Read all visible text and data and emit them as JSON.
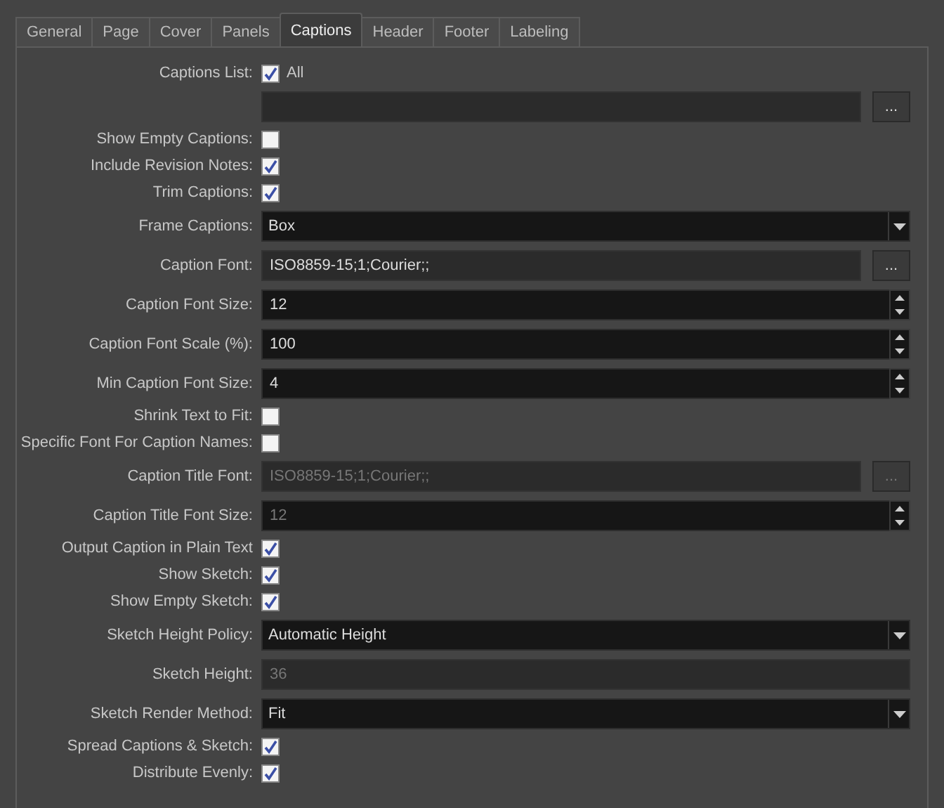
{
  "tabs": [
    {
      "label": "General",
      "selected": false
    },
    {
      "label": "Page",
      "selected": false
    },
    {
      "label": "Cover",
      "selected": false
    },
    {
      "label": "Panels",
      "selected": false
    },
    {
      "label": "Captions",
      "selected": true
    },
    {
      "label": "Header",
      "selected": false
    },
    {
      "label": "Footer",
      "selected": false
    },
    {
      "label": "Labeling",
      "selected": false
    }
  ],
  "rows": [
    {
      "kind": "checkbox",
      "label": "Captions List:",
      "checked": true,
      "text": "All"
    },
    {
      "kind": "browse",
      "button": "..."
    },
    {
      "kind": "checkbox",
      "label": "Show Empty Captions:",
      "checked": false
    },
    {
      "kind": "checkbox",
      "label": "Include Revision Notes:",
      "checked": true
    },
    {
      "kind": "checkbox",
      "label": "Trim Captions:",
      "checked": true
    },
    {
      "kind": "combo",
      "label": "Frame Captions:",
      "value": "Box"
    },
    {
      "kind": "browse",
      "label": "Caption Font:",
      "value": "ISO8859-15;1;Courier;;",
      "disabled": false,
      "button": "..."
    },
    {
      "kind": "spin",
      "label": "Caption Font Size:",
      "value": "12",
      "disabled": false
    },
    {
      "kind": "spin",
      "label": "Caption Font Scale (%):",
      "value": "100",
      "disabled": false
    },
    {
      "kind": "spin",
      "label": "Min Caption Font Size:",
      "value": "4",
      "disabled": false
    },
    {
      "kind": "checkbox",
      "label": "Shrink Text to Fit:",
      "checked": false
    },
    {
      "kind": "checkbox",
      "label": "Specific Font For Caption Names:",
      "checked": false
    },
    {
      "kind": "browse",
      "label": "Caption Title Font:",
      "value": "ISO8859-15;1;Courier;;",
      "disabled": true,
      "button": "..."
    },
    {
      "kind": "spin",
      "label": "Caption Title Font Size:",
      "value": "12",
      "disabled": true
    },
    {
      "kind": "checkbox",
      "label": "Output Caption in Plain Text",
      "checked": true
    },
    {
      "kind": "checkbox",
      "label": "Show Sketch:",
      "checked": true
    },
    {
      "kind": "checkbox",
      "label": "Show Empty Sketch:",
      "checked": true
    },
    {
      "kind": "combo",
      "label": "Sketch Height Policy:",
      "value": "Automatic Height"
    },
    {
      "kind": "text",
      "label": "Sketch Height:",
      "value": "36",
      "disabled": true
    },
    {
      "kind": "combo",
      "label": "Sketch Render Method:",
      "value": "Fit"
    },
    {
      "kind": "checkbox",
      "label": "Spread Captions & Sketch:",
      "checked": true
    },
    {
      "kind": "checkbox",
      "label": "Distribute Evenly:",
      "checked": true
    }
  ]
}
